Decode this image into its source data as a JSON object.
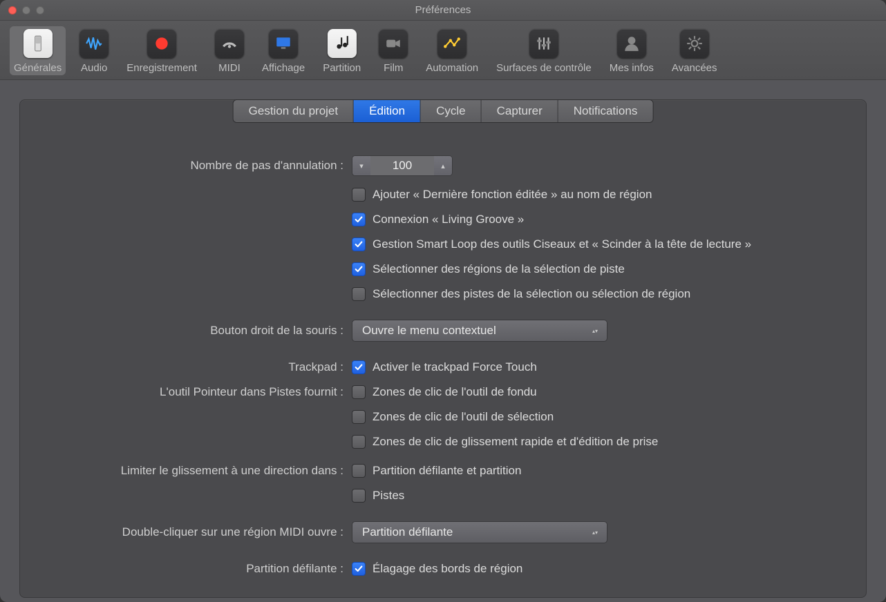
{
  "window": {
    "title": "Préférences"
  },
  "toolbar": [
    {
      "key": "generales",
      "label": "Générales",
      "icon": "switch",
      "selected": true
    },
    {
      "key": "audio",
      "label": "Audio",
      "icon": "waveform"
    },
    {
      "key": "enregistrement",
      "label": "Enregistrement",
      "icon": "record"
    },
    {
      "key": "midi",
      "label": "MIDI",
      "icon": "dial"
    },
    {
      "key": "affichage",
      "label": "Affichage",
      "icon": "monitor"
    },
    {
      "key": "partition",
      "label": "Partition",
      "icon": "score"
    },
    {
      "key": "film",
      "label": "Film",
      "icon": "camera"
    },
    {
      "key": "automation",
      "label": "Automation",
      "icon": "automation"
    },
    {
      "key": "surfaces",
      "label": "Surfaces de contrôle",
      "icon": "sliders"
    },
    {
      "key": "mesinfos",
      "label": "Mes infos",
      "icon": "person"
    },
    {
      "key": "avancees",
      "label": "Avancées",
      "icon": "gear"
    }
  ],
  "tabs": [
    {
      "label": "Gestion du projet"
    },
    {
      "label": "Édition",
      "active": true
    },
    {
      "label": "Cycle"
    },
    {
      "label": "Capturer"
    },
    {
      "label": "Notifications"
    }
  ],
  "form": {
    "undoStepsLabel": "Nombre de pas d'annulation :",
    "undoStepsValue": "100",
    "chk_addLastEdited": {
      "checked": false,
      "label": "Ajouter « Dernière fonction éditée » au nom de région"
    },
    "chk_livingGroove": {
      "checked": true,
      "label": "Connexion « Living Groove »"
    },
    "chk_smartLoop": {
      "checked": true,
      "label": "Gestion Smart Loop des outils Ciseaux et « Scinder à la tête de lecture »"
    },
    "chk_selRegions": {
      "checked": true,
      "label": "Sélectionner des régions de la sélection de piste"
    },
    "chk_selTracks": {
      "checked": false,
      "label": "Sélectionner des pistes de la sélection ou sélection de région"
    },
    "rightClickLabel": "Bouton droit de la souris :",
    "rightClickValue": "Ouvre le menu contextuel",
    "trackpadLabel": "Trackpad :",
    "chk_forceTouch": {
      "checked": true,
      "label": "Activer le trackpad Force Touch"
    },
    "pointerToolLabel": "L'outil Pointeur dans Pistes fournit :",
    "chk_fadeZones": {
      "checked": false,
      "label": "Zones de clic de l'outil de fondu"
    },
    "chk_selectZones": {
      "checked": false,
      "label": "Zones de clic de l'outil de sélection"
    },
    "chk_quickSwipeZones": {
      "checked": false,
      "label": "Zones de clic de glissement rapide et d'édition de prise"
    },
    "limitDragLabel": "Limiter le glissement à une direction dans :",
    "chk_pianoRoll": {
      "checked": false,
      "label": "Partition défilante et partition"
    },
    "chk_tracks": {
      "checked": false,
      "label": "Pistes"
    },
    "dblClickLabel": "Double-cliquer sur une région MIDI ouvre :",
    "dblClickValue": "Partition défilante",
    "pianoRollLabel": "Partition défilante :",
    "chk_trimEdges": {
      "checked": true,
      "label": "Élagage des bords de région"
    }
  }
}
